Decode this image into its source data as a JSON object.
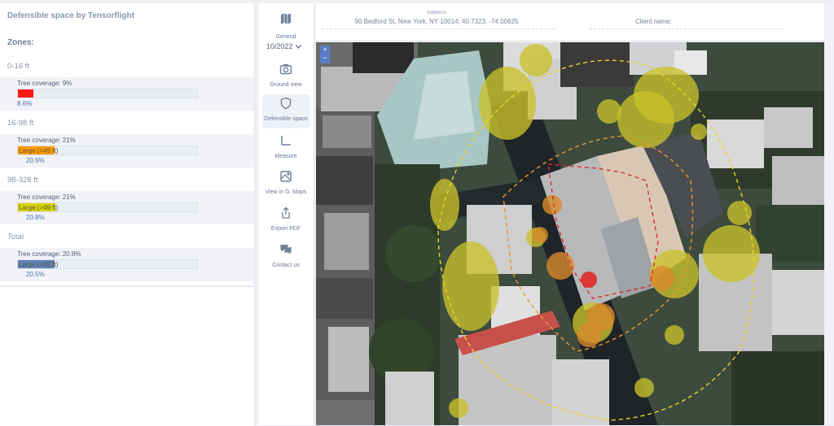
{
  "app": {
    "title": "Defensible space by Tensorflight"
  },
  "zones": {
    "title": "Zones:",
    "items": [
      {
        "label": "0-16 ft",
        "coverage": "Tree coverage: 9%",
        "bar_label": "",
        "bar_fill": 0.086,
        "bar_color": "#ff1a1a",
        "percent": "8.6%"
      },
      {
        "label": "16-98 ft",
        "coverage": "Tree coverage: 21%",
        "bar_label": "Large (>49 ft)",
        "bar_fill": 0.206,
        "bar_color": "#ff9a00",
        "percent": "20.6%"
      },
      {
        "label": "98-328 ft",
        "coverage": "Tree coverage: 21%",
        "bar_label": "Large (>49 ft)",
        "bar_fill": 0.208,
        "bar_color": "#d9d400",
        "percent": "20.8%"
      },
      {
        "label": "Total",
        "coverage": "Tree coverage: 20.8%",
        "bar_label": "Large (>49 ft)",
        "bar_fill": 0.205,
        "bar_color": "#5e82b8",
        "percent": "20.5%"
      }
    ]
  },
  "toolbar": {
    "general": "General",
    "date": "10/2022",
    "ground_view": "Ground view",
    "defensible_space": "Defensible space",
    "measure": "Measure",
    "view_gmaps": "View in G. Maps",
    "export_pdf": "Export PDF",
    "contact_us": "Contact us"
  },
  "header": {
    "address_label": "Address",
    "address_value": "90 Bedford St, New York, NY 10014; 40.7323, -74.00625",
    "client_label": "Client name:"
  },
  "map": {
    "zoom_in": "+",
    "zoom_out": "−"
  }
}
